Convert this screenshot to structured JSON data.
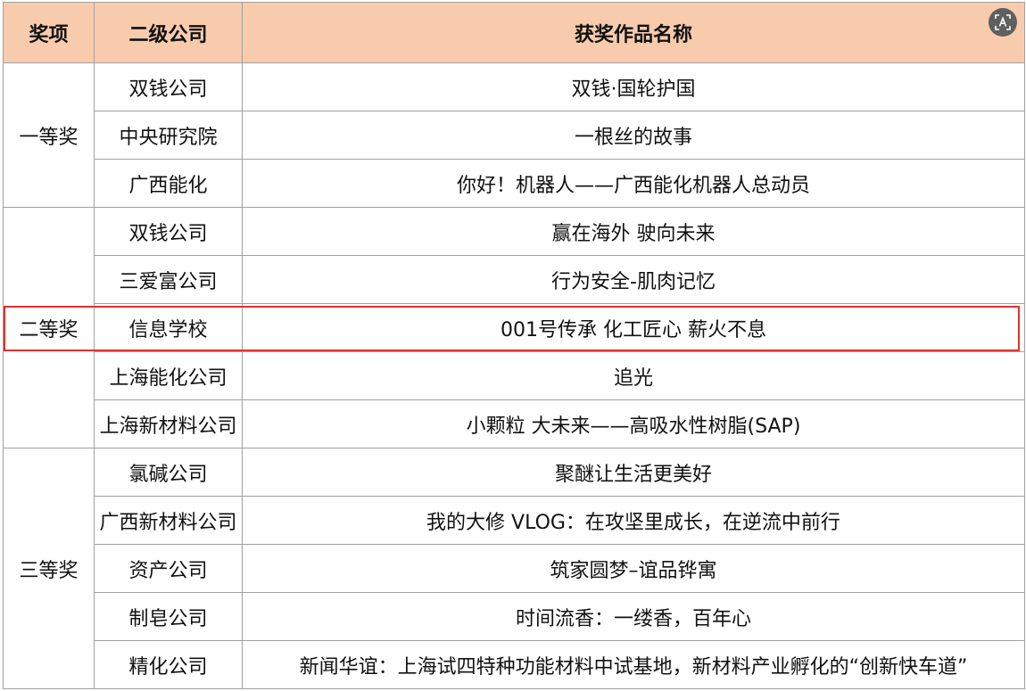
{
  "header": {
    "col_award": "奖项",
    "col_company": "二级公司",
    "col_work": "获奖作品名称"
  },
  "groups": [
    {
      "award": "一等奖",
      "rows": [
        {
          "company": "双钱公司",
          "work": "双钱·国轮护国"
        },
        {
          "company": "中央研究院",
          "work": "一根丝的故事"
        },
        {
          "company": "广西能化",
          "work": "你好！机器人——广西能化机器人总动员"
        }
      ]
    },
    {
      "award": "二等奖",
      "rows": [
        {
          "company": "双钱公司",
          "work": "赢在海外 驶向未来"
        },
        {
          "company": "三爱富公司",
          "work": "行为安全-肌肉记忆"
        },
        {
          "company": "信息学校",
          "work": "001号传承 化工匠心 薪火不息"
        },
        {
          "company": "上海能化公司",
          "work": "追光"
        },
        {
          "company": "上海新材料公司",
          "work": "小颗粒 大未来——高吸水性树脂(SAP)"
        }
      ]
    },
    {
      "award": "三等奖",
      "rows": [
        {
          "company": "氯碱公司",
          "work": "聚醚让生活更美好"
        },
        {
          "company": "广西新材料公司",
          "work": "我的大修 VLOG：在攻坚里成长，在逆流中前行"
        },
        {
          "company": "资产公司",
          "work": "筑家圆梦–谊品铧寓"
        },
        {
          "company": "制皂公司",
          "work": "时间流香：一缕香，百年心"
        },
        {
          "company": "精化公司",
          "work": "新闻华谊：上海试四特种功能材料中试基地，新材料产业孵化的“创新快车道”"
        }
      ]
    }
  ],
  "icons": {
    "corner_button": "text-recognition-icon"
  },
  "colors": {
    "header_bg": "#f8cbad",
    "highlight_border": "#e0322c",
    "grid": "#a0a0a0"
  }
}
